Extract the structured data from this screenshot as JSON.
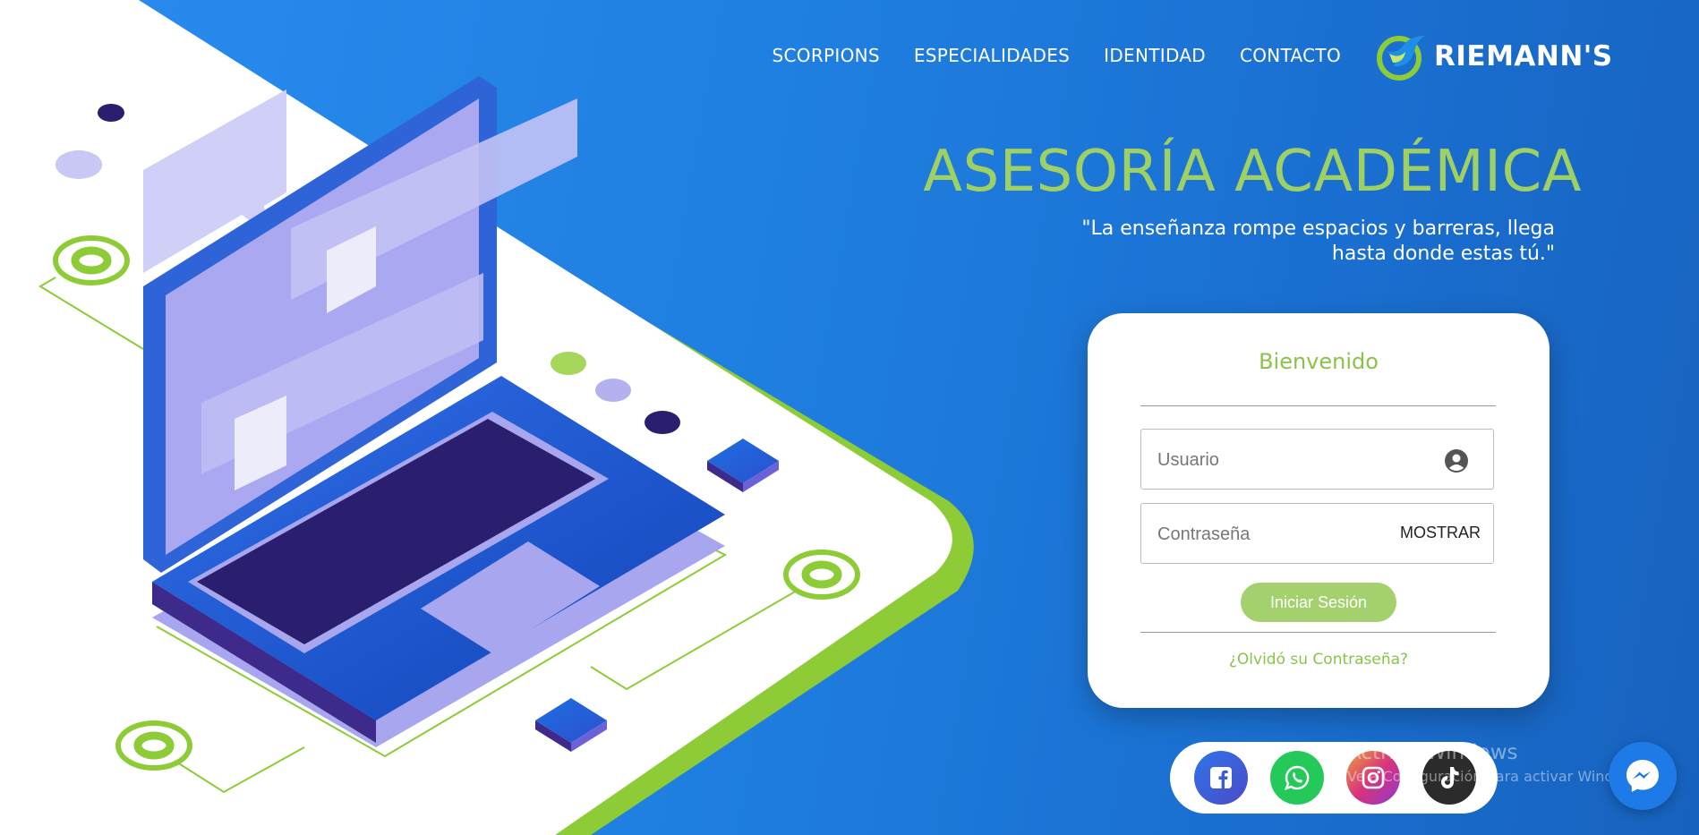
{
  "nav": {
    "items": [
      {
        "label": "SCORPIONS"
      },
      {
        "label": "ESPECIALIDADES"
      },
      {
        "label": "IDENTIDAD"
      },
      {
        "label": "CONTACTO"
      }
    ],
    "brand": "RIEMANN'S"
  },
  "hero": {
    "title": "ASESORÍA ACADÉMICA",
    "quote_line1": "\"La enseñanza rompe espacios y barreras, llega",
    "quote_line2": "hasta donde estas tú.\""
  },
  "login": {
    "title": "Bienvenido",
    "username_placeholder": "Usuario",
    "username_value": "",
    "password_placeholder": "Contraseña",
    "password_value": "",
    "show_label": "MOSTRAR",
    "submit_label": "Iniciar Sesión",
    "forgot_label": "¿Olvidó su Contraseña?"
  },
  "social": [
    {
      "icon": "facebook-icon",
      "color": "#3b5ccc"
    },
    {
      "icon": "whatsapp-icon",
      "color": "#25c95a"
    },
    {
      "icon": "instagram-icon",
      "color": "#d9337a"
    },
    {
      "icon": "tiktok-icon",
      "color": "#333333"
    }
  ],
  "watermark": {
    "line1": "Activar Windows",
    "line2": "Ve a Configuración para activar Windows."
  },
  "colors": {
    "accent_green": "#8bc34a",
    "button_green": "#a5d06e",
    "background_blue": "#1f80e4"
  }
}
